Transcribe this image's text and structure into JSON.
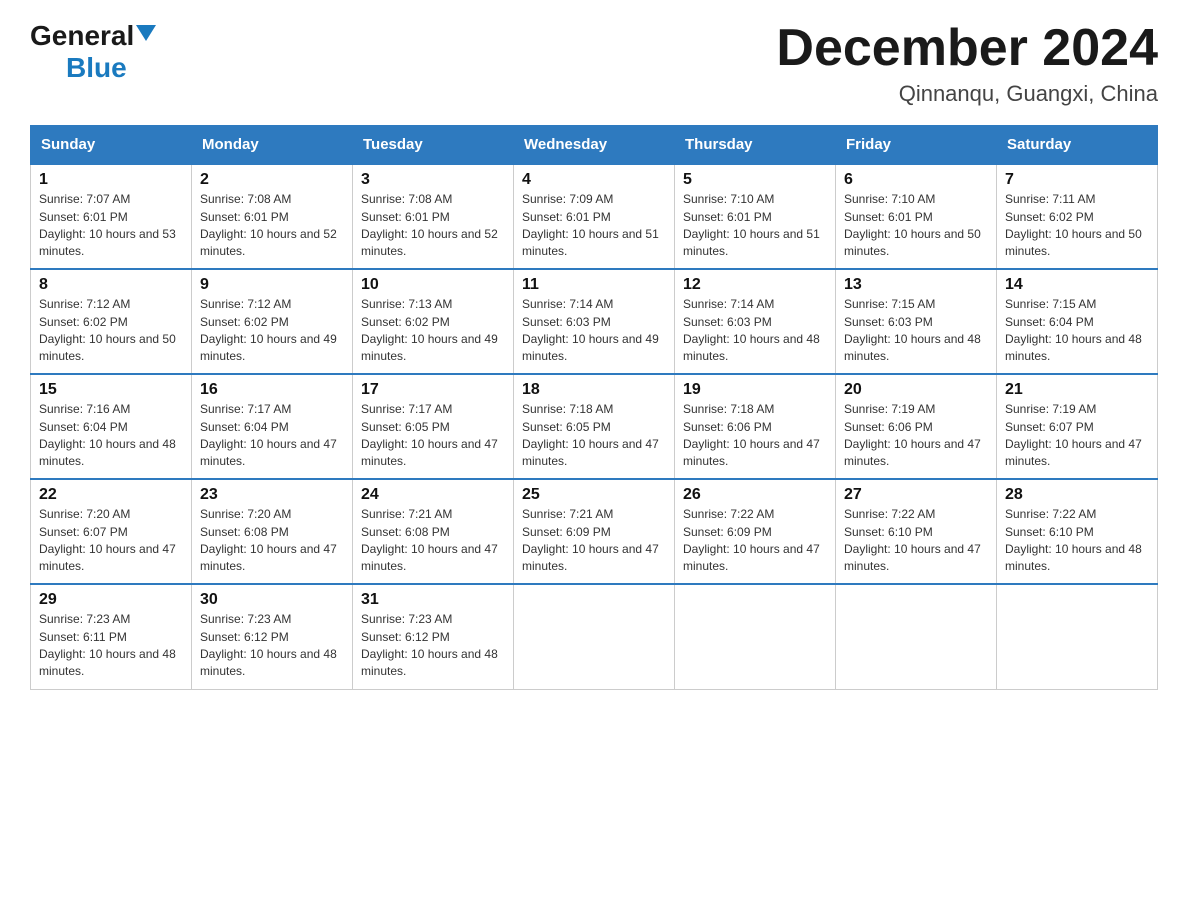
{
  "header": {
    "logo_general": "General",
    "logo_blue": "Blue",
    "title": "December 2024",
    "subtitle": "Qinnanqu, Guangxi, China"
  },
  "days_of_week": [
    "Sunday",
    "Monday",
    "Tuesday",
    "Wednesday",
    "Thursday",
    "Friday",
    "Saturday"
  ],
  "weeks": [
    [
      {
        "day": "1",
        "sunrise": "7:07 AM",
        "sunset": "6:01 PM",
        "daylight": "10 hours and 53 minutes."
      },
      {
        "day": "2",
        "sunrise": "7:08 AM",
        "sunset": "6:01 PM",
        "daylight": "10 hours and 52 minutes."
      },
      {
        "day": "3",
        "sunrise": "7:08 AM",
        "sunset": "6:01 PM",
        "daylight": "10 hours and 52 minutes."
      },
      {
        "day": "4",
        "sunrise": "7:09 AM",
        "sunset": "6:01 PM",
        "daylight": "10 hours and 51 minutes."
      },
      {
        "day": "5",
        "sunrise": "7:10 AM",
        "sunset": "6:01 PM",
        "daylight": "10 hours and 51 minutes."
      },
      {
        "day": "6",
        "sunrise": "7:10 AM",
        "sunset": "6:01 PM",
        "daylight": "10 hours and 50 minutes."
      },
      {
        "day": "7",
        "sunrise": "7:11 AM",
        "sunset": "6:02 PM",
        "daylight": "10 hours and 50 minutes."
      }
    ],
    [
      {
        "day": "8",
        "sunrise": "7:12 AM",
        "sunset": "6:02 PM",
        "daylight": "10 hours and 50 minutes."
      },
      {
        "day": "9",
        "sunrise": "7:12 AM",
        "sunset": "6:02 PM",
        "daylight": "10 hours and 49 minutes."
      },
      {
        "day": "10",
        "sunrise": "7:13 AM",
        "sunset": "6:02 PM",
        "daylight": "10 hours and 49 minutes."
      },
      {
        "day": "11",
        "sunrise": "7:14 AM",
        "sunset": "6:03 PM",
        "daylight": "10 hours and 49 minutes."
      },
      {
        "day": "12",
        "sunrise": "7:14 AM",
        "sunset": "6:03 PM",
        "daylight": "10 hours and 48 minutes."
      },
      {
        "day": "13",
        "sunrise": "7:15 AM",
        "sunset": "6:03 PM",
        "daylight": "10 hours and 48 minutes."
      },
      {
        "day": "14",
        "sunrise": "7:15 AM",
        "sunset": "6:04 PM",
        "daylight": "10 hours and 48 minutes."
      }
    ],
    [
      {
        "day": "15",
        "sunrise": "7:16 AM",
        "sunset": "6:04 PM",
        "daylight": "10 hours and 48 minutes."
      },
      {
        "day": "16",
        "sunrise": "7:17 AM",
        "sunset": "6:04 PM",
        "daylight": "10 hours and 47 minutes."
      },
      {
        "day": "17",
        "sunrise": "7:17 AM",
        "sunset": "6:05 PM",
        "daylight": "10 hours and 47 minutes."
      },
      {
        "day": "18",
        "sunrise": "7:18 AM",
        "sunset": "6:05 PM",
        "daylight": "10 hours and 47 minutes."
      },
      {
        "day": "19",
        "sunrise": "7:18 AM",
        "sunset": "6:06 PM",
        "daylight": "10 hours and 47 minutes."
      },
      {
        "day": "20",
        "sunrise": "7:19 AM",
        "sunset": "6:06 PM",
        "daylight": "10 hours and 47 minutes."
      },
      {
        "day": "21",
        "sunrise": "7:19 AM",
        "sunset": "6:07 PM",
        "daylight": "10 hours and 47 minutes."
      }
    ],
    [
      {
        "day": "22",
        "sunrise": "7:20 AM",
        "sunset": "6:07 PM",
        "daylight": "10 hours and 47 minutes."
      },
      {
        "day": "23",
        "sunrise": "7:20 AM",
        "sunset": "6:08 PM",
        "daylight": "10 hours and 47 minutes."
      },
      {
        "day": "24",
        "sunrise": "7:21 AM",
        "sunset": "6:08 PM",
        "daylight": "10 hours and 47 minutes."
      },
      {
        "day": "25",
        "sunrise": "7:21 AM",
        "sunset": "6:09 PM",
        "daylight": "10 hours and 47 minutes."
      },
      {
        "day": "26",
        "sunrise": "7:22 AM",
        "sunset": "6:09 PM",
        "daylight": "10 hours and 47 minutes."
      },
      {
        "day": "27",
        "sunrise": "7:22 AM",
        "sunset": "6:10 PM",
        "daylight": "10 hours and 47 minutes."
      },
      {
        "day": "28",
        "sunrise": "7:22 AM",
        "sunset": "6:10 PM",
        "daylight": "10 hours and 48 minutes."
      }
    ],
    [
      {
        "day": "29",
        "sunrise": "7:23 AM",
        "sunset": "6:11 PM",
        "daylight": "10 hours and 48 minutes."
      },
      {
        "day": "30",
        "sunrise": "7:23 AM",
        "sunset": "6:12 PM",
        "daylight": "10 hours and 48 minutes."
      },
      {
        "day": "31",
        "sunrise": "7:23 AM",
        "sunset": "6:12 PM",
        "daylight": "10 hours and 48 minutes."
      },
      null,
      null,
      null,
      null
    ]
  ]
}
